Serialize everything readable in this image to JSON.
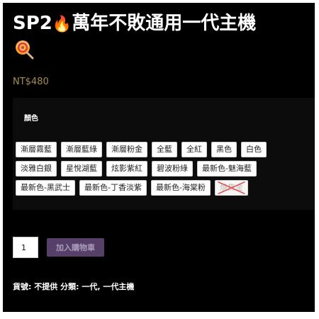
{
  "product": {
    "title_prefix": "SP2",
    "title_fire_emoji": "🔥",
    "title_suffix": "萬年不敗通用一代主機",
    "price": "NT$480"
  },
  "variations": {
    "label": "顏色",
    "options": [
      {
        "label": "漸層霧藍",
        "available": true
      },
      {
        "label": "漸層藍綠",
        "available": true
      },
      {
        "label": "漸層粉金",
        "available": true
      },
      {
        "label": "全藍",
        "available": true
      },
      {
        "label": "全紅",
        "available": true
      },
      {
        "label": "黑色",
        "available": true
      },
      {
        "label": "白色",
        "available": true
      },
      {
        "label": "淡雅白銀",
        "available": true
      },
      {
        "label": "星悅湖藍",
        "available": true
      },
      {
        "label": "炫影紫紅",
        "available": true
      },
      {
        "label": "碧波粉綠",
        "available": true
      },
      {
        "label": "最新色-魅海藍",
        "available": true
      },
      {
        "label": "最新色-黑武士",
        "available": true
      },
      {
        "label": "最新色-丁香淡紫",
        "available": true
      },
      {
        "label": "最新色-海棠粉",
        "available": true
      },
      {
        "label": "燒焦金",
        "available": false
      }
    ]
  },
  "cart": {
    "quantity": "1",
    "add_to_cart_label": "加入購物車"
  },
  "meta": {
    "sku_label": "貨號:",
    "sku_value": "不提供",
    "category_label": "分類:",
    "categories": [
      "一代",
      "一代主機"
    ],
    "category_separator": ","
  },
  "colors": {
    "background": "#000000",
    "price": "#a58d4c",
    "button": "#563f69",
    "button_text": "#a999b6"
  },
  "icons": [
    "fire-icon",
    "lollipop-icon",
    "unavailable-cross-icon"
  ]
}
